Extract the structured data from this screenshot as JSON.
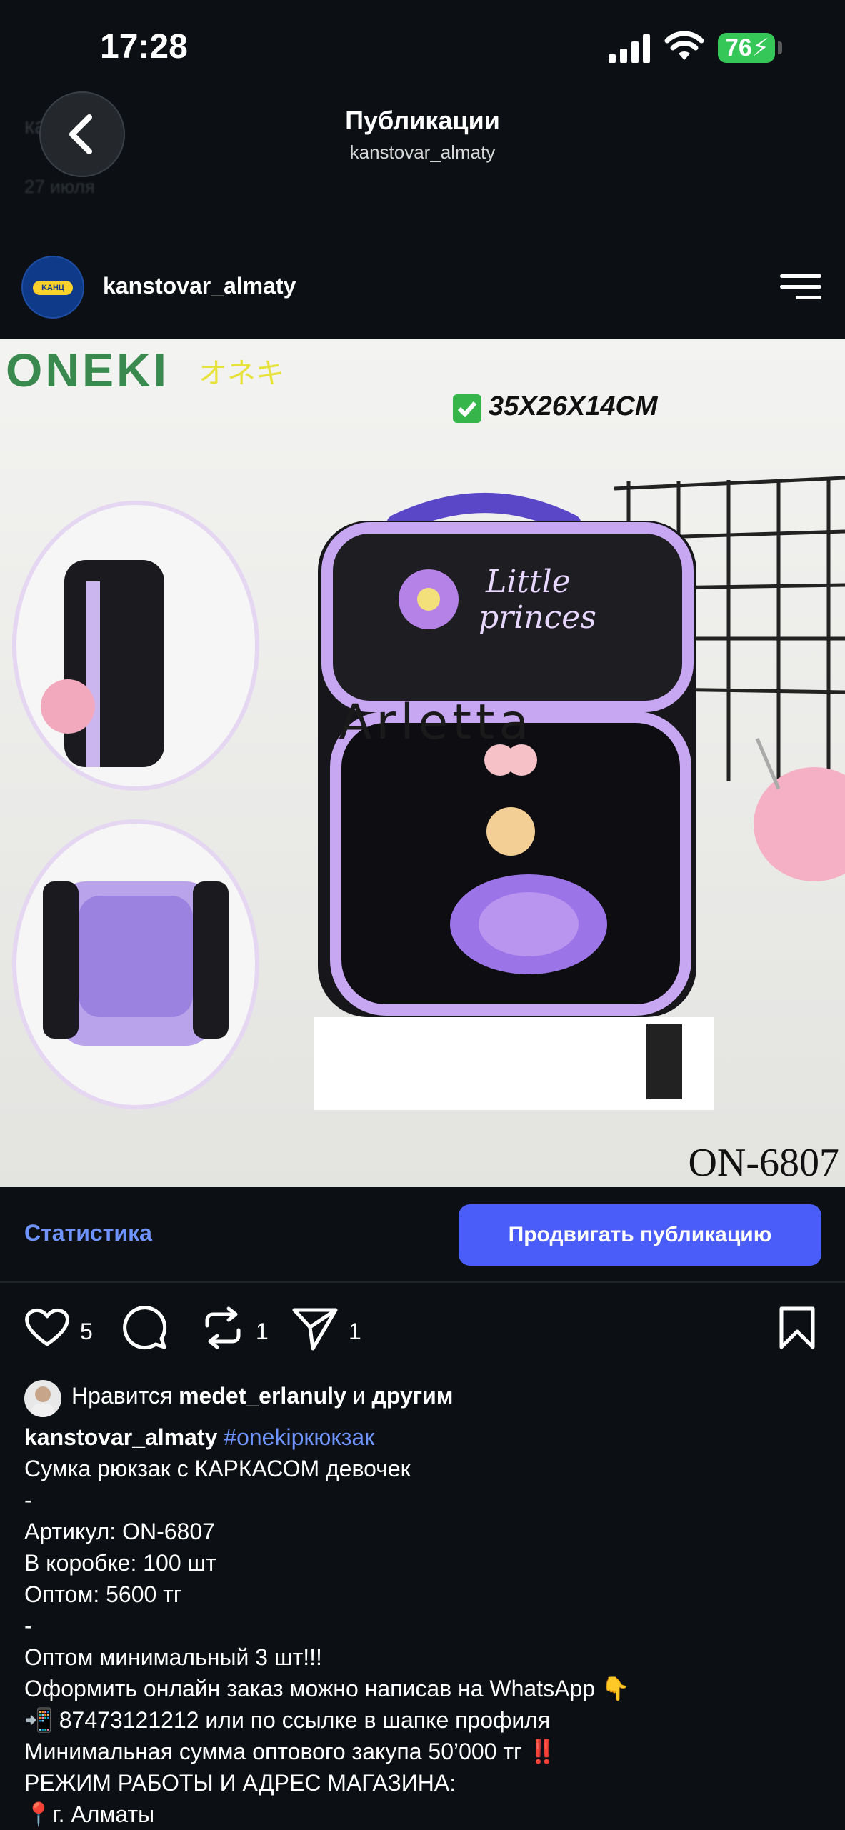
{
  "status_bar": {
    "time": "17:28",
    "battery": "76",
    "icons": [
      "signal-icon",
      "wifi-icon",
      "battery-icon"
    ]
  },
  "background_peek": {
    "line1": "кa....",
    "date": "27 июля"
  },
  "header": {
    "title": "Публикации",
    "subtitle": "kanstovar_almaty",
    "back_icon": "chevron-left-icon"
  },
  "account": {
    "name": "kanstovar_almaty",
    "avatar_text": "KАНЦ TREND"
  },
  "photo": {
    "brand": "ONEKI",
    "brand_jp": "オネキ",
    "dimensions": "35X26X14CM",
    "article": "ON-6807",
    "base_label": "Arletta"
  },
  "promo_bar": {
    "stats_label": "Статистика",
    "promote_label": "Продвигать публикацию"
  },
  "actions": {
    "likes": "5",
    "reposts": "1",
    "shares": "1"
  },
  "liked_by": {
    "prefix": "Нравится",
    "user": "medet_erlanuly",
    "and": "и",
    "others": "другим"
  },
  "caption": {
    "user": "kanstovar_almaty",
    "hashtag": "#onekiркюкзак",
    "lines": [
      "Сумка рюкзак с КАРКАСОМ девочек",
      "-",
      "Артикул: ON-6807",
      "В коробке: 100 шт",
      "Оптом: 5600 тг",
      "-",
      "Оптом минимальный 3 шт!!!",
      "Оформить онлайн заказ можно написав на WhatsApp 👇",
      "📲 87473121212 или по ссылке в шапке профиля",
      "Минимальная сумма оптового закупа 50’000 тг ‼️",
      "РЕЖИМ РАБОТЫ И АДРЕС МАГАЗИНА:",
      "📍г. Алматы"
    ]
  },
  "colors": {
    "background": "#0c1014",
    "accent": "#4a5df9",
    "link": "#6f94ff"
  }
}
